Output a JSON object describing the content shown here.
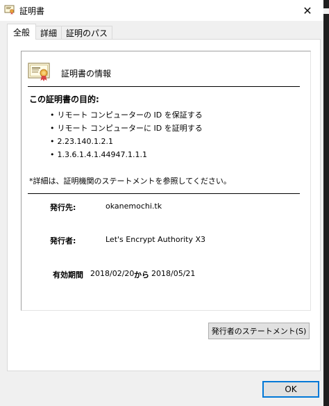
{
  "window": {
    "title": "証明書",
    "close_glyph": "✕",
    "icon": "certificate-icon"
  },
  "tabs": [
    {
      "label": "全般",
      "active": true
    },
    {
      "label": "詳細",
      "active": false
    },
    {
      "label": "証明のパス",
      "active": false
    }
  ],
  "info": {
    "title": "証明書の情報",
    "icon": "certificate-ribbon-icon"
  },
  "purpose": {
    "title": "この証明書の目的:",
    "items": [
      "リモート コンピューターの ID を保証する",
      "リモート コンピューターに ID を証明する",
      "2.23.140.1.2.1",
      "1.3.6.1.4.1.44947.1.1.1"
    ]
  },
  "note": "*詳細は、証明機関のステートメントを参照してください。",
  "fields": {
    "issued_to_label": "発行先:",
    "issued_to_value": "okanemochi.tk",
    "issued_by_label": "発行者:",
    "issued_by_value": "Let's Encrypt Authority X3",
    "validity_label": "有効期間",
    "valid_from": "2018/02/20",
    "validity_sep": "から",
    "valid_to": "2018/05/21"
  },
  "buttons": {
    "issuer_statement": "発行者のステートメント(S)",
    "ok": "OK"
  },
  "colors": {
    "ok_border": "#0078d7",
    "dialog_bg": "#f0f0f0"
  }
}
